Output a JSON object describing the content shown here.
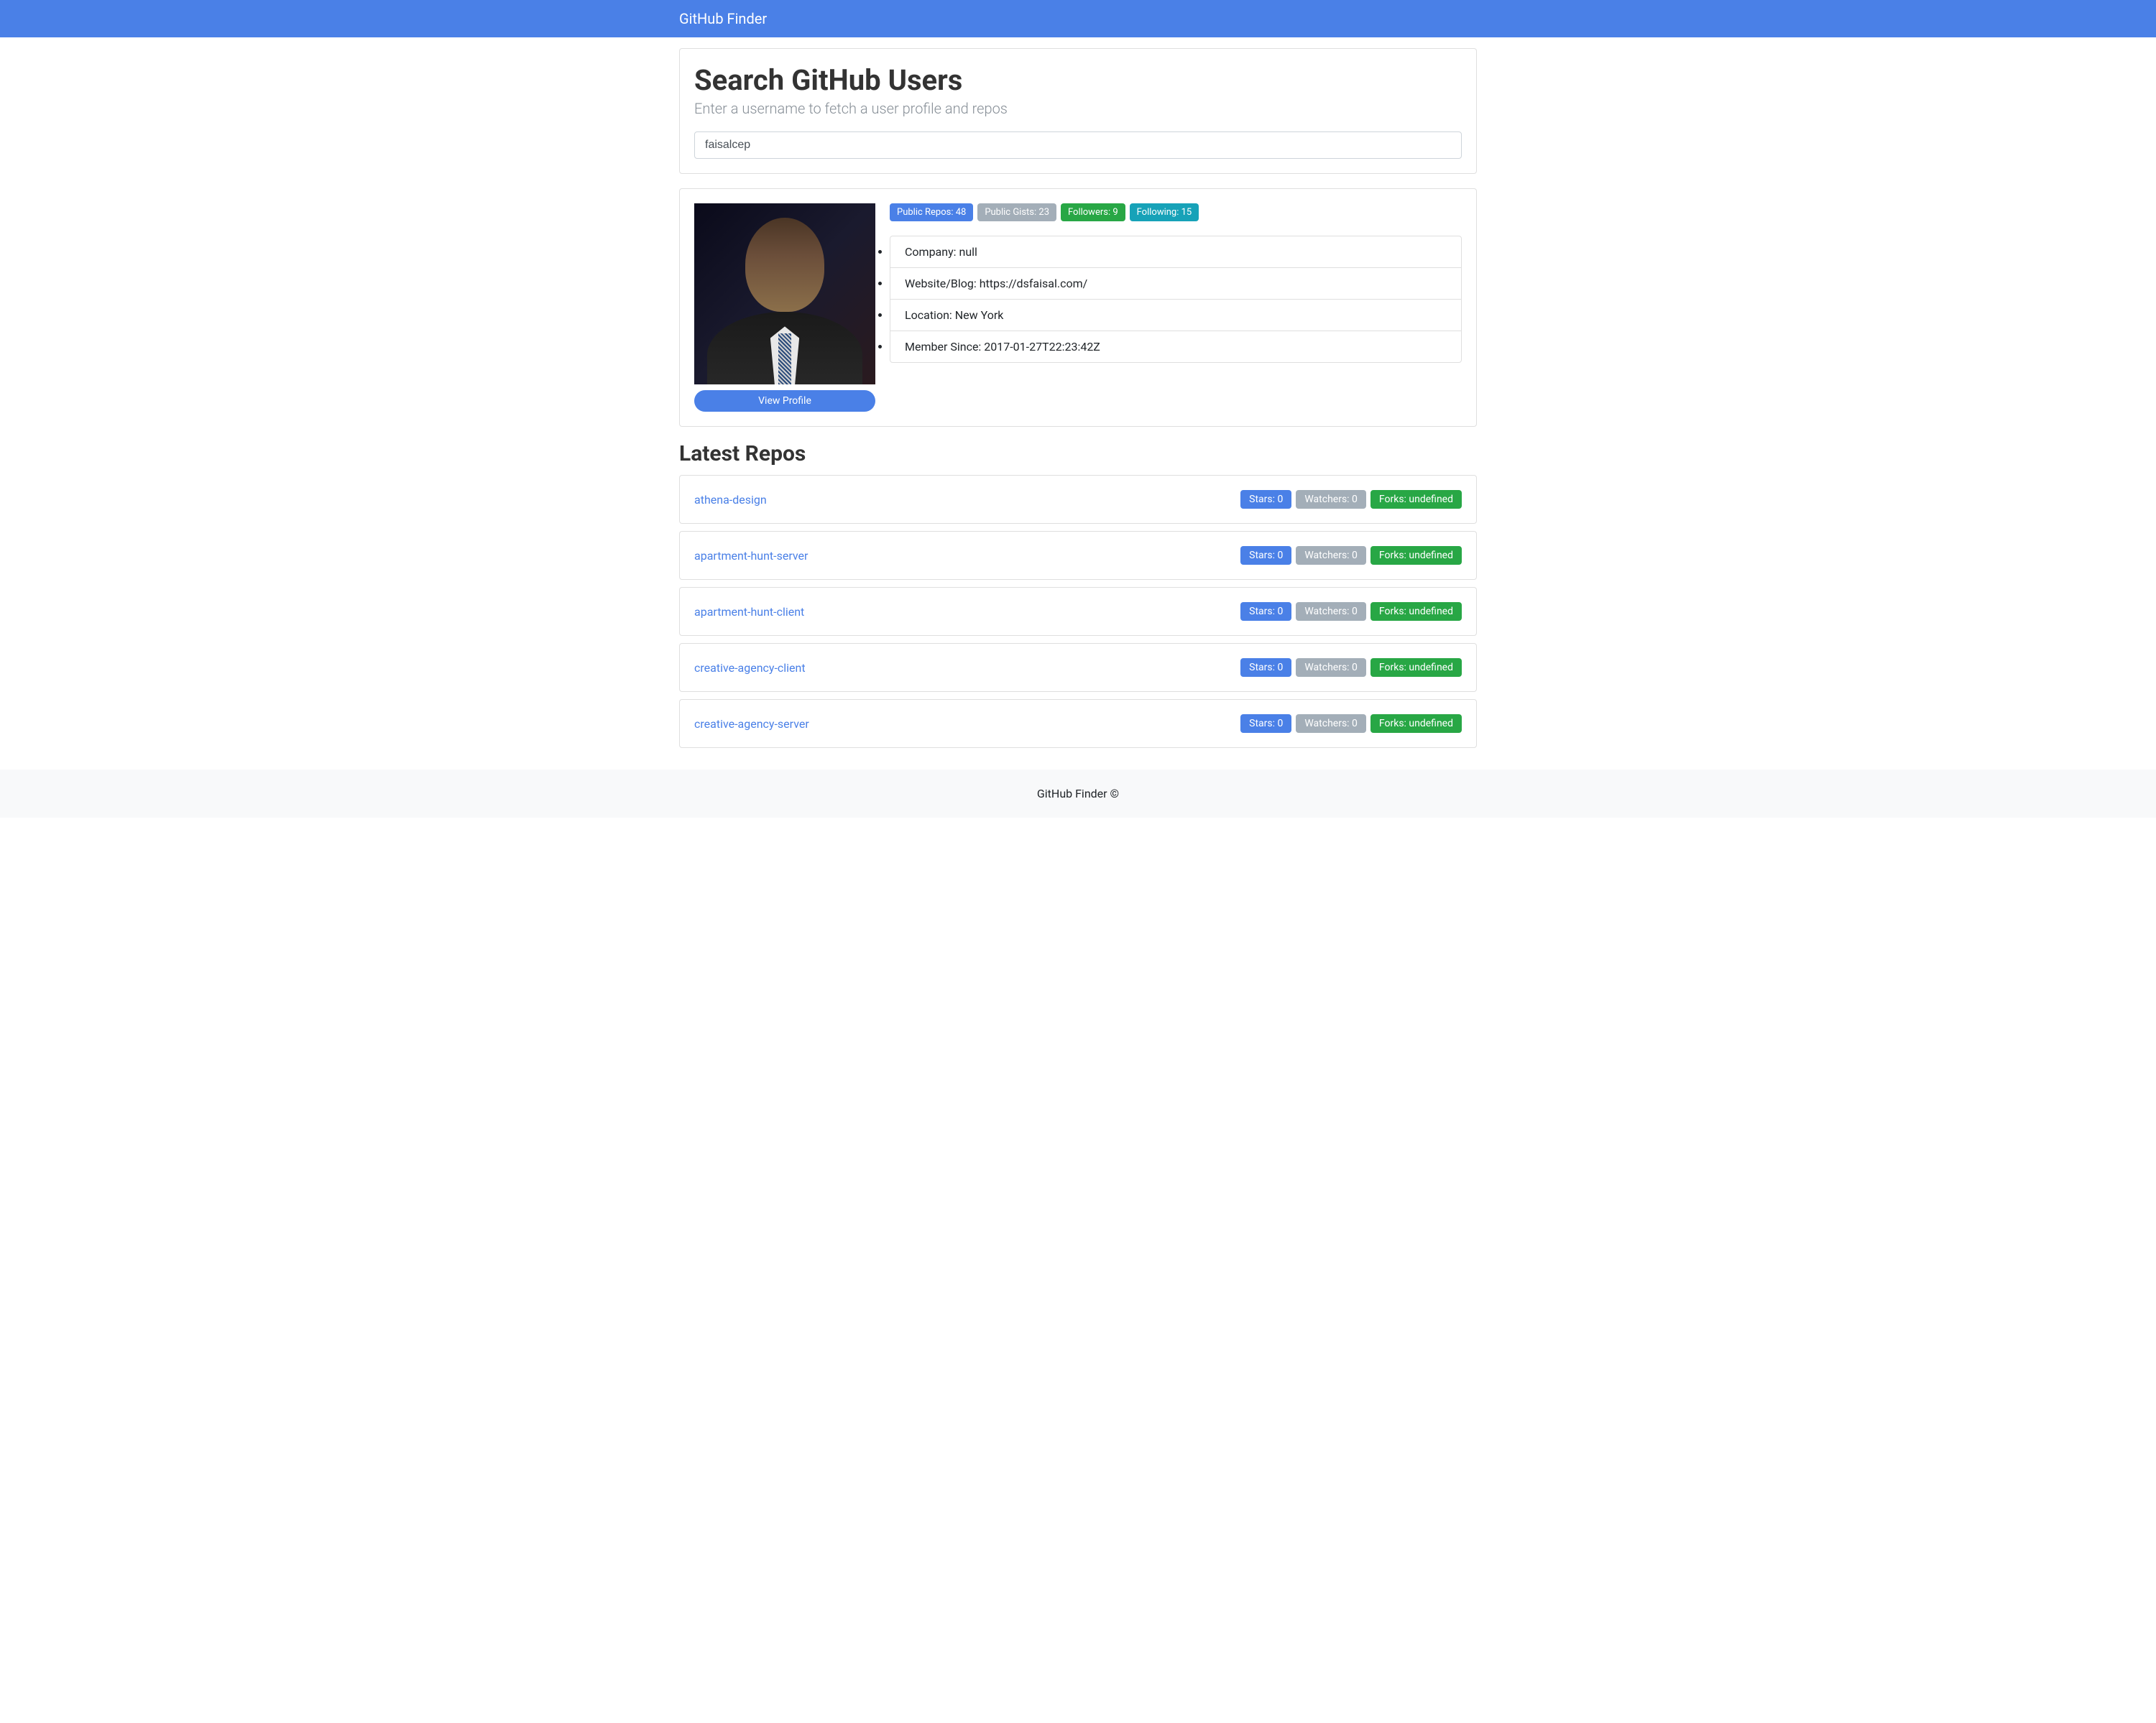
{
  "navbar": {
    "brand": "GitHub Finder"
  },
  "search": {
    "title": "Search GitHub Users",
    "subtitle": "Enter a username to fetch a user profile and repos",
    "value": "faisalcep"
  },
  "profile": {
    "view_profile_label": "View Profile",
    "badges": {
      "public_repos": "Public Repos: 48",
      "public_gists": "Public Gists: 23",
      "followers": "Followers: 9",
      "following": "Following: 15"
    },
    "details": {
      "company": "Company: null",
      "website": "Website/Blog: https://dsfaisal.com/",
      "location": "Location: New York",
      "member_since": "Member Since: 2017-01-27T22:23:42Z"
    }
  },
  "repos": {
    "heading": "Latest Repos",
    "items": [
      {
        "name": "athena-design",
        "stars": "Stars: 0",
        "watchers": "Watchers: 0",
        "forks": "Forks: undefined"
      },
      {
        "name": "apartment-hunt-server",
        "stars": "Stars: 0",
        "watchers": "Watchers: 0",
        "forks": "Forks: undefined"
      },
      {
        "name": "apartment-hunt-client",
        "stars": "Stars: 0",
        "watchers": "Watchers: 0",
        "forks": "Forks: undefined"
      },
      {
        "name": "creative-agency-client",
        "stars": "Stars: 0",
        "watchers": "Watchers: 0",
        "forks": "Forks: undefined"
      },
      {
        "name": "creative-agency-server",
        "stars": "Stars: 0",
        "watchers": "Watchers: 0",
        "forks": "Forks: undefined"
      }
    ]
  },
  "footer": {
    "text": "GitHub Finder ©"
  }
}
